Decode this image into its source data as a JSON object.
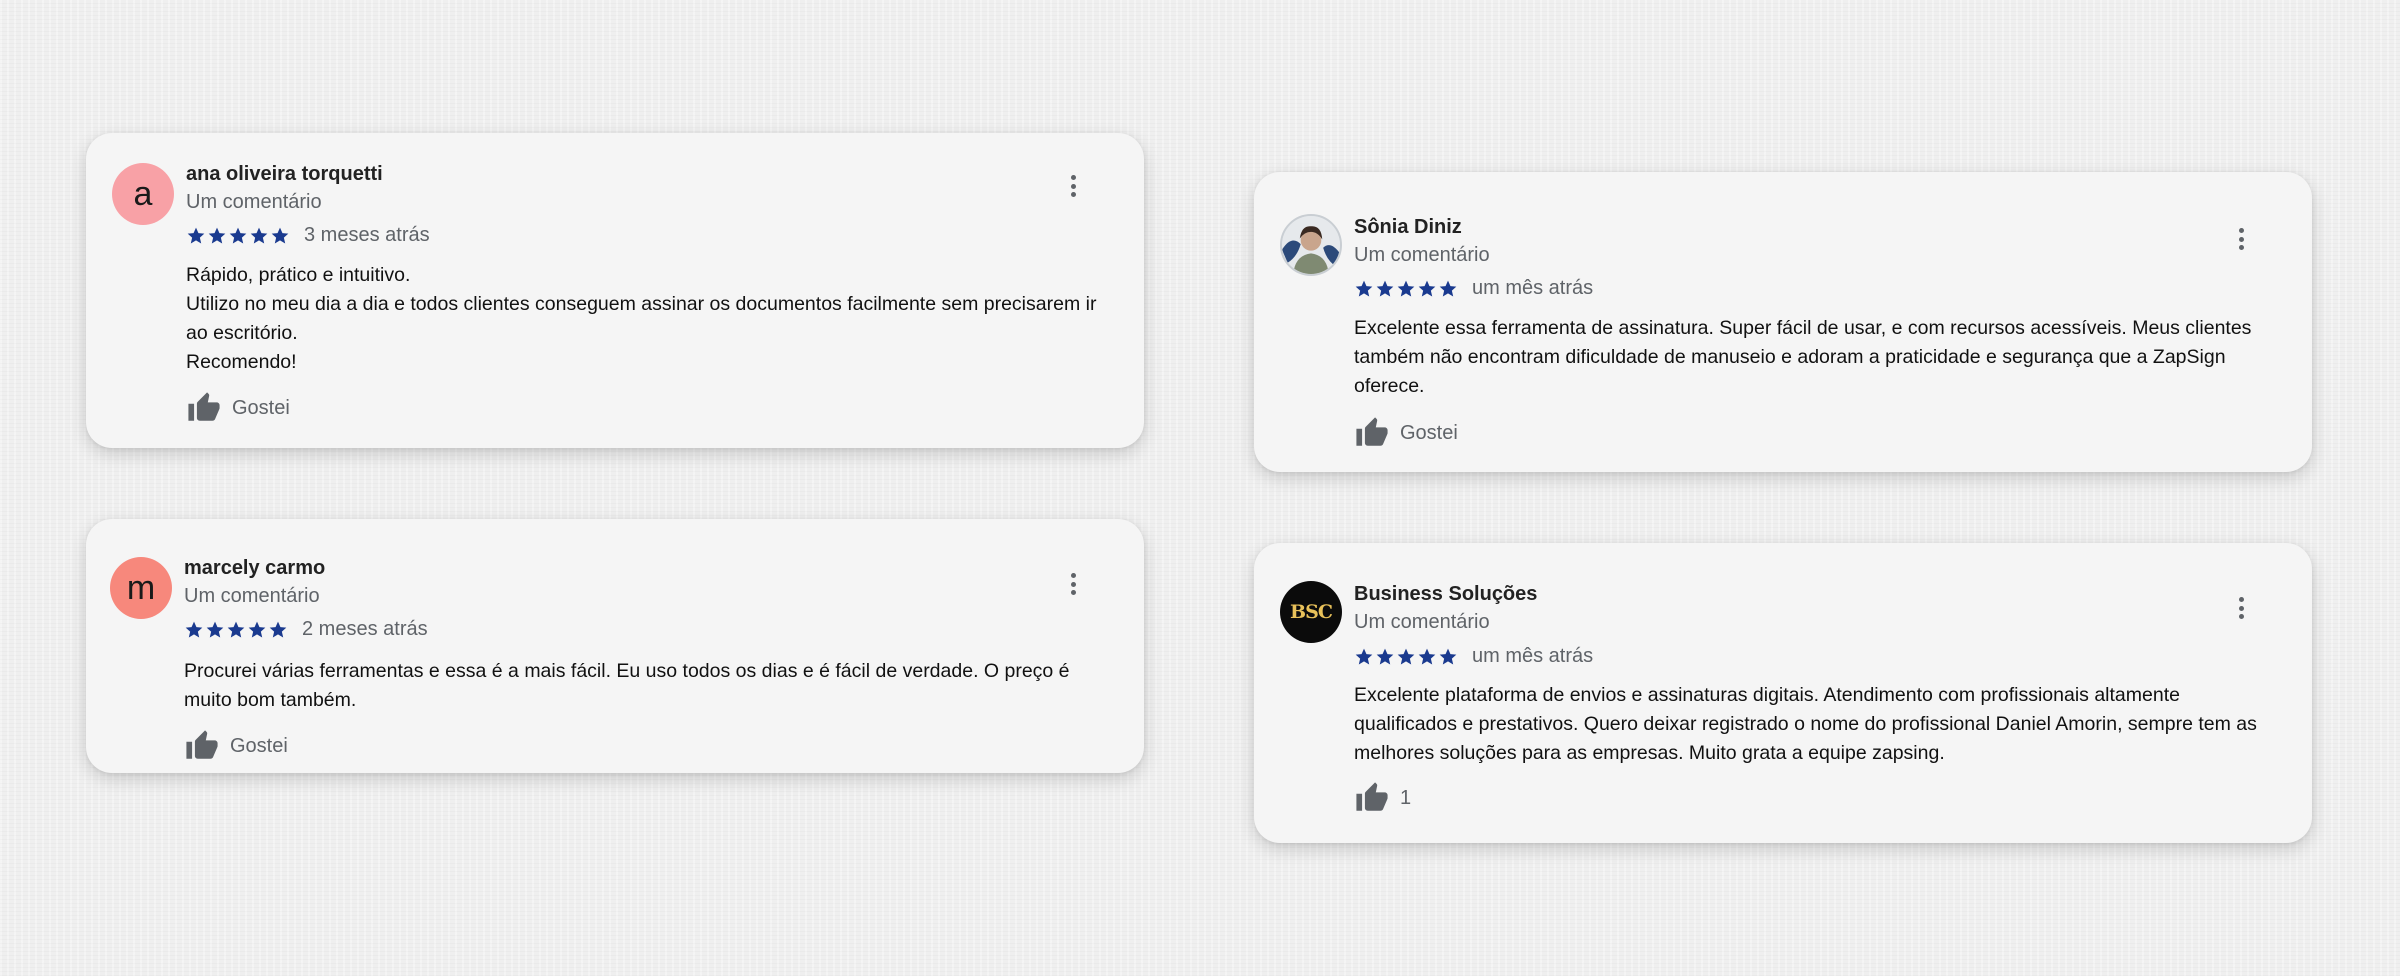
{
  "reviews": [
    {
      "author": "ana oliveira torquetti",
      "initial": "a",
      "avatar_color": "#f8a1a6",
      "subtitle": "Um comentário",
      "rating": 5,
      "time": "3 meses atrás",
      "lines": [
        "Rápido, prático e intuitivo.",
        "Utilizo no meu dia a dia e todos clientes conseguem assinar os documentos facilmente sem precisarem ir ao escritório.",
        "Recomendo!"
      ],
      "like_label": "Gostei"
    },
    {
      "author": "marcely carmo",
      "initial": "m",
      "avatar_color": "#f7887c",
      "subtitle": "Um comentário",
      "rating": 5,
      "time": "2 meses atrás",
      "lines": [
        "Procurei várias ferramentas e essa é a mais fácil. Eu uso todos os dias e é fácil de verdade. O preço é muito bom também."
      ],
      "like_label": "Gostei"
    },
    {
      "author": "Sônia Diniz",
      "subtitle": "Um comentário",
      "rating": 5,
      "time": "um mês atrás",
      "lines": [
        "Excelente essa ferramenta de assinatura. Super fácil de usar, e com recursos acessíveis. Meus clientes também não encontram dificuldade de manuseio e adoram a praticidade e segurança que a ZapSign oferece."
      ],
      "like_label": "Gostei"
    },
    {
      "author": "Business Soluções",
      "avatar_logo": "BSC",
      "subtitle": "Um comentário",
      "rating": 5,
      "time": "um mês atrás",
      "lines": [
        "Excelente plataforma de envios e assinaturas digitais. Atendimento com profissionais altamente qualificados e prestativos. Quero deixar registrado o nome do profissional Daniel Amorin, sempre tem as melhores soluções para as empresas. Muito grata a equipe zapsing."
      ],
      "like_label": "1"
    }
  ],
  "colors": {
    "star": "#1a3a8f",
    "card_bg": "#f5f5f5",
    "muted_text": "#5f6368",
    "icon": "#5f6368"
  },
  "icons": {
    "star": "star-icon",
    "menu": "more-vert-icon",
    "like": "thumb-up-icon"
  }
}
